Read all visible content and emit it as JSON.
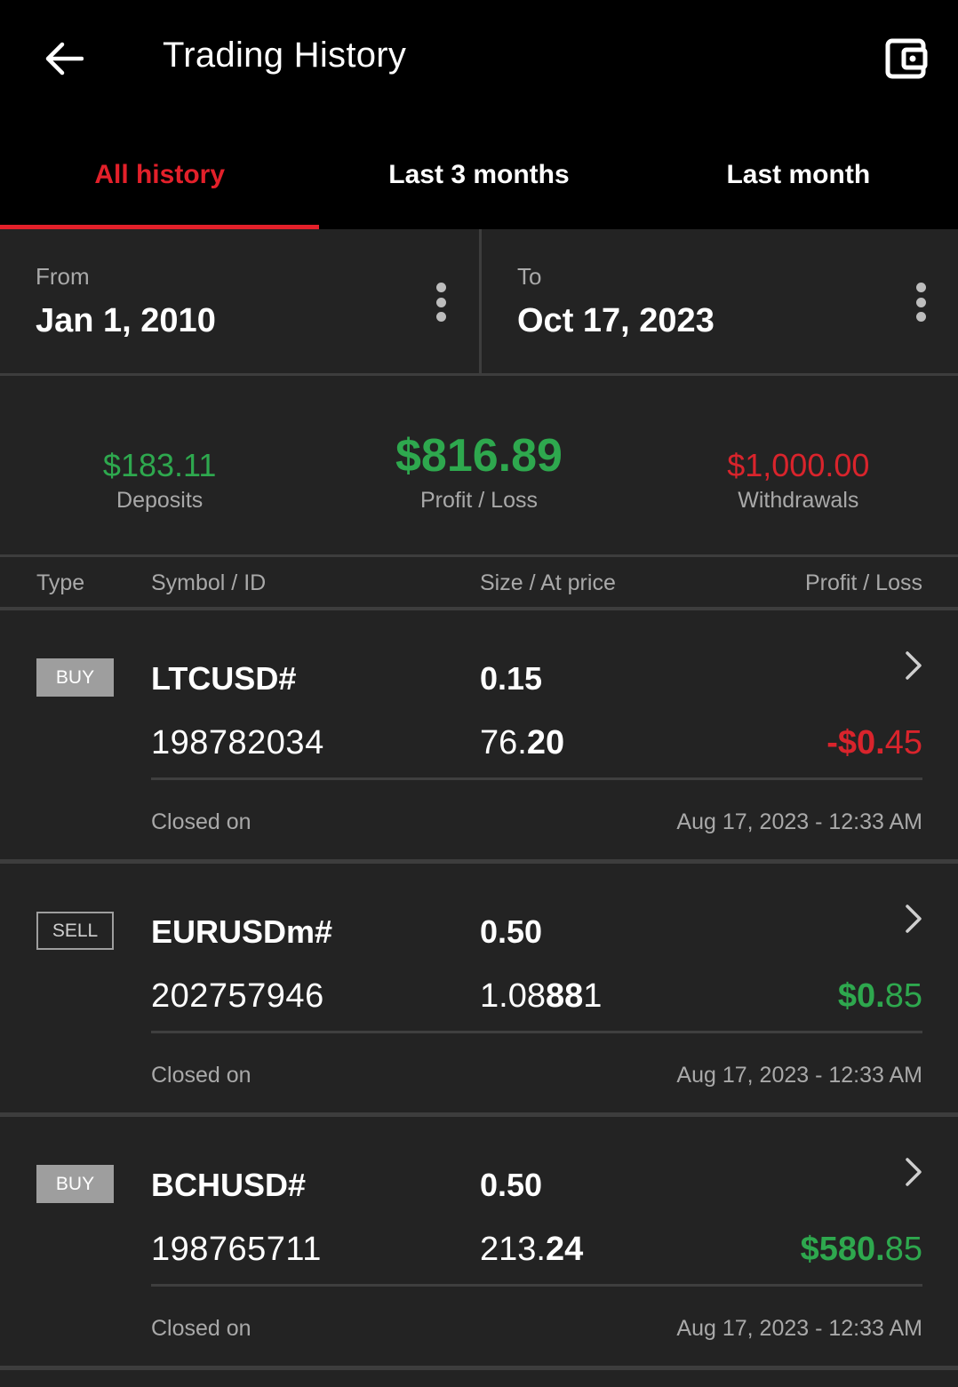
{
  "header": {
    "title": "Trading History",
    "back_icon": "arrow-left-icon",
    "wallet_icon": "wallet-icon"
  },
  "tabs": [
    {
      "label": "All history",
      "active": true
    },
    {
      "label": "Last 3 months",
      "active": false
    },
    {
      "label": "Last month",
      "active": false
    }
  ],
  "range": {
    "from_label": "From",
    "from_value": "Jan 1, 2010",
    "to_label": "To",
    "to_value": "Oct 17, 2023"
  },
  "summary": {
    "deposits_value": "$183.11",
    "deposits_label": "Deposits",
    "profit_value": "$816.89",
    "profit_label": "Profit / Loss",
    "withdrawals_value": "$1,000.00",
    "withdrawals_label": "Withdrawals"
  },
  "table_header": {
    "type": "Type",
    "symbol": "Symbol / ID",
    "size": "Size / At price",
    "pl": "Profit / Loss"
  },
  "colors": {
    "accent_red": "#e3202a",
    "profit_green": "#2ea84e",
    "loss_red": "#d9242c"
  },
  "trades": [
    {
      "type": "BUY",
      "symbol": "LTCUSD#",
      "id": "198782034",
      "size": "0.15",
      "price_main": "76.",
      "price_bold": "20",
      "pl_main": "-$0.",
      "pl_tail": "45",
      "closed_label": "Closed on",
      "closed_date": "Aug 17, 2023 - 12:33 AM"
    },
    {
      "type": "SELL",
      "symbol": "EURUSDm#",
      "id": "202757946",
      "size": "0.50",
      "price_main": "1.08",
      "price_bold": "88",
      "price_tail": "1",
      "pl_main": "$0.",
      "pl_tail": "85",
      "closed_label": "Closed on",
      "closed_date": "Aug 17, 2023 - 12:33 AM"
    },
    {
      "type": "BUY",
      "symbol": "BCHUSD#",
      "id": "198765711",
      "size": "0.50",
      "price_main": "213.",
      "price_bold": "24",
      "pl_main": "$580.",
      "pl_tail": "85",
      "closed_label": "Closed on",
      "closed_date": "Aug 17, 2023 - 12:33 AM"
    }
  ]
}
